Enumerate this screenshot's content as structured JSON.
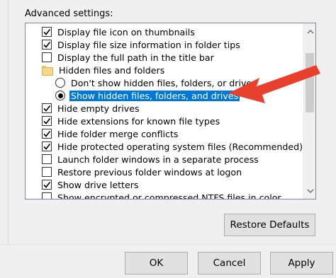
{
  "advanced_settings": {
    "label": "Advanced settings:",
    "items": [
      {
        "type": "checkbox",
        "checked": true,
        "label": "Display file icon on thumbnails"
      },
      {
        "type": "checkbox",
        "checked": true,
        "label": "Display file size information in folder tips"
      },
      {
        "type": "checkbox",
        "checked": false,
        "label": "Display the full path in the title bar"
      },
      {
        "type": "folder",
        "icon": "folder-icon",
        "label": "Hidden files and folders"
      },
      {
        "type": "radio",
        "checked": false,
        "label": "Don't show hidden files, folders, or drives"
      },
      {
        "type": "radio",
        "checked": true,
        "label": "Show hidden files, folders, and drives",
        "selected": true
      },
      {
        "type": "checkbox",
        "checked": true,
        "label": "Hide empty drives"
      },
      {
        "type": "checkbox",
        "checked": true,
        "label": "Hide extensions for known file types"
      },
      {
        "type": "checkbox",
        "checked": true,
        "label": "Hide folder merge conflicts"
      },
      {
        "type": "checkbox",
        "checked": true,
        "label": "Hide protected operating system files (Recommended)"
      },
      {
        "type": "checkbox",
        "checked": false,
        "label": "Launch folder windows in a separate process"
      },
      {
        "type": "checkbox",
        "checked": false,
        "label": "Restore previous folder windows at logon"
      },
      {
        "type": "checkbox",
        "checked": true,
        "label": "Show drive letters"
      },
      {
        "type": "checkbox",
        "checked": false,
        "label": "Show encrypted or compressed NTFS files in color"
      }
    ]
  },
  "buttons": {
    "restore_defaults": "Restore Defaults",
    "ok": "OK",
    "cancel": "Cancel",
    "apply": "Apply"
  },
  "colors": {
    "selection": "#0078d7",
    "annotation_arrow": "#e8402c"
  }
}
